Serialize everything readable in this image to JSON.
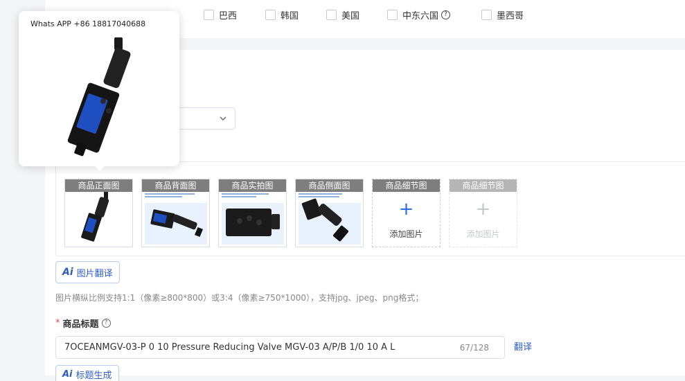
{
  "countries": [
    {
      "label": "巴西"
    },
    {
      "label": "韩国"
    },
    {
      "label": "美国"
    },
    {
      "label": "中东六国",
      "help_icon": "question-circle-icon"
    },
    {
      "label": "墨西哥"
    }
  ],
  "popover": {
    "text": "Whats APP +86 18817040688"
  },
  "images": {
    "tiles": [
      {
        "label": "商品正面图"
      },
      {
        "label": "商品背面图"
      },
      {
        "label": "商品实拍图"
      },
      {
        "label": "商品侧面图"
      }
    ],
    "slots": [
      {
        "label": "商品细节图",
        "add_text": "添加图片",
        "plus": "+"
      },
      {
        "label": "商品细节图",
        "add_text": "添加图片",
        "plus": "+"
      }
    ],
    "ai_translate_label": "图片翻译",
    "hint": "图片横纵比例支持1:1（像素≥800*800）或3:4（像素≥750*1000），支持jpg、jpeg、png格式；"
  },
  "title_field": {
    "required_mark": "*",
    "label": "商品标题",
    "value": "7OCEANMGV-03-P 0 10 Pressure Reducing Valve MGV-03 A/P/B 1/0 10 A L",
    "counter": "67/128",
    "translate_label": "翻译",
    "ai_generate_label": "标题生成"
  },
  "ai_glyph": "Ai",
  "colors": {
    "accent": "#2d5cc8",
    "plus_blue": "#2b6de5",
    "required": "#e34d4d",
    "product_blue": "#1f4fc0"
  }
}
